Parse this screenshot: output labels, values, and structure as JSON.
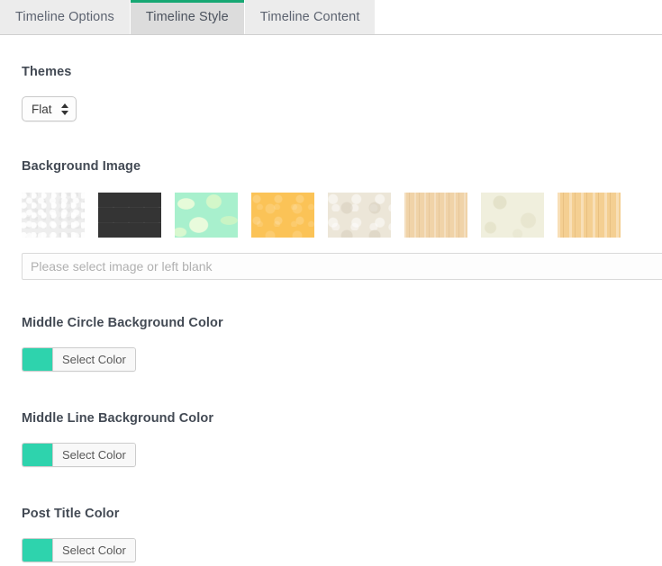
{
  "tabs": [
    {
      "label": "Timeline Options",
      "active": false
    },
    {
      "label": "Timeline Style",
      "active": true
    },
    {
      "label": "Timeline Content",
      "active": false
    }
  ],
  "theme_colors": {
    "active_tab_accent": "#16a873",
    "swatch_teal": "#2ed3ad",
    "heading": "#434a54",
    "tab_inactive_bg": "#ececec",
    "tab_active_bg": "#dcdcdc"
  },
  "themes": {
    "label": "Themes",
    "selected": "Flat",
    "options": [
      "Flat"
    ],
    "stepper_icon": "stepper-up-down-icon"
  },
  "background_image": {
    "label": "Background Image",
    "swatches": [
      {
        "name": "white-noise-texture",
        "color": "#eeeeee"
      },
      {
        "name": "dark-geometric-texture",
        "color": "#343434"
      },
      {
        "name": "mint-camo-texture",
        "color": "#a8f0cd"
      },
      {
        "name": "orange-doodle-texture",
        "color": "#fbc357"
      },
      {
        "name": "cream-floral-texture",
        "color": "#ece6d8"
      },
      {
        "name": "light-wood-texture",
        "color": "#f0d3a8"
      },
      {
        "name": "cream-ornate-texture",
        "color": "#f0efdd"
      },
      {
        "name": "wood-grain-texture",
        "color": "#f4cf92"
      }
    ],
    "input_placeholder": "Please select image or left blank",
    "input_value": ""
  },
  "color_fields": [
    {
      "label": "Middle Circle Background Color",
      "button_label": "Select Color",
      "value": "#2ed3ad"
    },
    {
      "label": "Middle Line Background Color",
      "button_label": "Select Color",
      "value": "#2ed3ad"
    },
    {
      "label": "Post Title Color",
      "button_label": "Select Color",
      "value": "#2ed3ad"
    }
  ]
}
